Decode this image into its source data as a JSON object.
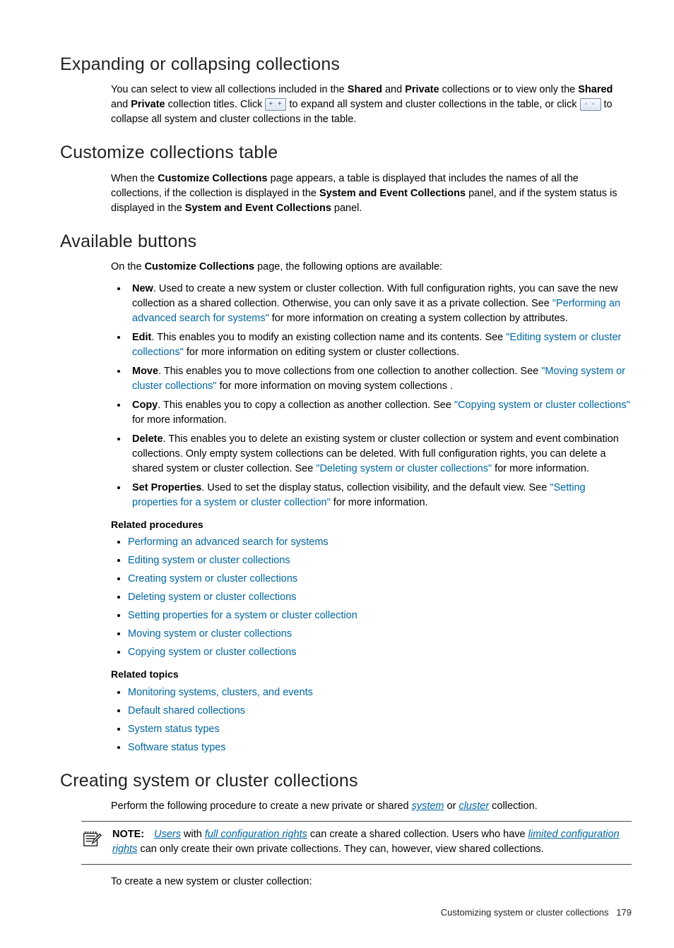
{
  "sec1": {
    "title": "Expanding or collapsing collections",
    "p1a": "You can select to view all collections included in the ",
    "shared": "Shared",
    "p1b": " and ",
    "private": "Private",
    "p1c": " collections or to view only the ",
    "p2a": " collection titles. Click ",
    "p2b": " to expand all system and cluster collections in the table, or click ",
    "p2c": " to collapse all system and cluster collections in the table."
  },
  "sec2": {
    "title": "Customize collections table",
    "p1a": "When the ",
    "bold1": "Customize Collections",
    "p1b": " page appears, a table is displayed that includes the names of all the collections, if the collection is displayed in the ",
    "bold2": "System and Event Collections",
    "p1c": " panel, and if the system status is displayed in the ",
    "p1d": " panel."
  },
  "sec3": {
    "title": "Available buttons",
    "intro_a": "On the ",
    "intro_bold": "Customize Collections",
    "intro_b": " page, the following options are available:",
    "items": [
      {
        "name": "New",
        "t1": ". Used to create a new system or cluster collection. With full configuration rights, you can save the new collection as a shared collection. Otherwise, you can only save it as a private collection. See ",
        "link": "\"Performing an advanced search for systems\"",
        "t2": " for more information on creating a system collection by attributes."
      },
      {
        "name": "Edit",
        "t1": ". This enables you to modify an existing collection name and its contents. See ",
        "link": "\"Editing system or cluster collections\"",
        "t2": " for more information on editing system or cluster collections."
      },
      {
        "name": "Move",
        "t1": ". This enables you to move collections from one collection to another collection. See ",
        "link": "\"Moving system or cluster collections\"",
        "t2": " for more information on moving system collections ."
      },
      {
        "name": "Copy",
        "t1": ". This enables you to copy a collection as another collection. See ",
        "link": "\"Copying system or cluster collections\"",
        "t2": " for more information."
      },
      {
        "name": "Delete",
        "t1": ". This enables you to delete an existing system or cluster collection or system and event combination collections. Only empty system collections can be deleted. With full configuration rights, you can delete a shared system or cluster collection. See ",
        "link": "\"Deleting system or cluster collections\"",
        "t2": " for more information."
      },
      {
        "name": "Set Properties",
        "t1": ". Used to set the display status, collection visibility, and the default view. See ",
        "link": "\"Setting properties for a system or cluster collection\"",
        "t2": " for more information."
      }
    ],
    "rel_proc_head": "Related procedures",
    "rel_proc": [
      "Performing an advanced search for systems",
      "Editing system or cluster collections",
      "Creating system or cluster collections",
      "Deleting system or cluster collections",
      "Setting properties for a system or cluster collection",
      "Moving system or cluster collections",
      "Copying system or cluster collections"
    ],
    "rel_top_head": "Related topics",
    "rel_top": [
      "Monitoring systems, clusters, and events",
      "Default shared collections",
      "System status types",
      "Software status types"
    ]
  },
  "sec4": {
    "title": "Creating system or cluster collections",
    "p1a": "Perform the following procedure to create a new private or shared ",
    "g1": "system",
    "p1b": " or ",
    "g2": "cluster",
    "p1c": " collection.",
    "note_label": "NOTE:",
    "note_a": "Users",
    "note_b": " with ",
    "note_c": "full configuration rights",
    "note_d": " can create a shared collection. Users who have ",
    "note_e": "limited configuration rights",
    "note_f": " can only create their own private collections. They can, however, view shared collections.",
    "p2": "To create a new system or cluster collection:"
  },
  "footer": {
    "text": "Customizing system or cluster collections",
    "page": "179"
  }
}
